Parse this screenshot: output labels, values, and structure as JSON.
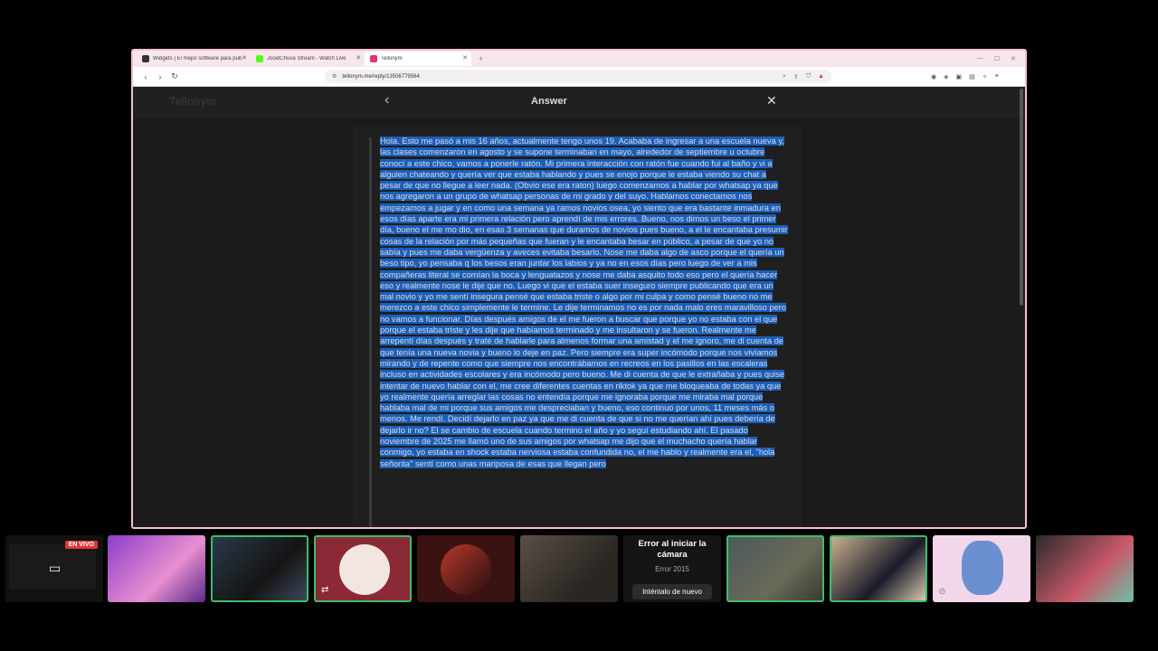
{
  "browser": {
    "tabs": [
      {
        "title": "Widgets | El mejor software para pub",
        "favicon_color": "#333333"
      },
      {
        "title": "JooidChuva Stream - Watch Live",
        "favicon_color": "#53fc18"
      },
      {
        "title": "Tellonym",
        "favicon_color": "#e5326b"
      }
    ],
    "new_tab": "+",
    "url": "tellonym.me/reply/13506779564"
  },
  "page": {
    "site_name": "Tellonym",
    "dialog_title": "Answer",
    "back_icon": "‹",
    "close_icon": "✕",
    "message": "Hola. Esto me pasó a mis 16 años, actualmente tengo unos 19. Acababa de ingresar a una escuela nueva y, las clases comenzaron en agosto y se supone terminaban en mayo, alrededor de septiembre u octubre conocí a este chico, vamos a ponerle ratón. Mi primera interacción con ratón fue cuando fui al baño y vi a alguien chateando y quería ver que estaba hablando y pues se enojo porque le estaba viendo su chat a pesar de que no llegue a leer nada. (Obvio ese era raton) luego comenzamos a hablar por whatsap ya que nos agregaron a un grupo de whatsap personas de mi grado y del suyo. Hablamos conectamos nos empezamos a jugar y en como una semana ya ramos novios osea, yo siento que era bastante inmadura en esos días aparte era mi primera relación pero aprendí de mis errores. Bueno, nos dimos un beso el primer día, bueno el me mo dio, en esas 3 semanas que duramos de novios pues bueno, a el le encantaba presumir cosas de la relación por más pequeñas que fueran y le encantaba besar en público, a pesar de que yo no sabía y pues me daba vergüenza y aveces evitaba besarlo. Nose me daba algo de asco porque el quería un beso tipo, yo pensaba q los besos eran juntar los labios y ya no en esos días pero luego de ver a mis compañeras literal se comían la boca y lenguatazos y nose me daba asquito todo eso pero el quería hacer eso y realmente nose le dije que no. Luego vi que el estaba suer inseguro siempre publicando que era un mal novio y yo me sentí insegura pensé que estaba triste o algo por mi culpa y como pensé bueno no me merezco a este chico simplemente le termine. Le dije terminamos no es por nada malo eres maravilloso pero no vamos a funcionar. Días después amigos de el me fueron a buscar que porque yo no estaba con el que porque el estaba triste y les dije que habíamos terminado y me insultaron y se fueron. Realmente me arrepentí días después y traté de hablarle para almenos formar una amistad y el me ignoro, me di cuenta de que tenía una nueva novia y bueno lo deje en paz. Pero siempre era super incómodo porque nos vivíamos mirando y de repente como que siempre nos encontrábamos en recreos en los pasillos en las escaleras incluso en actividades escolares y era incómodo pero bueno. Me di cuenta de que le extrañaba y pues quise intentar de nuevo hablar con el, me cree diferentes cuentas en riktok ya que me bloqueaba de todas ya que yo realmente quería arreglar las cosas no entendía porque me ignoraba porque me miraba mal porque hablaba mal de mi porque sus amigos me despreciaban y bueno, eso continuo por unos, 11 meses más o menos. Me rendí. Decidí dejarlo en paz ya que me di cuenta de que si no me querían ahí pues debería de dejarlo ir no? El se cambio de escuela cuando termino el año y yo seguí estudiando ahí. El pasado noviembre de 2025 me llamó uno de sus amigos por whatsap me dijo que el muchacho quería hablar conmigo, yo estaba en shock estaba nerviosa estaba confundida no, el me hablo y realmente era el, \"hola señorita\" sentí como unas mariposa de esas que llegan pero"
  },
  "stream_strip": {
    "live_badge": "EN VIVO",
    "camera_error": {
      "title": "Error al iniciar la cámara",
      "code": "Error 2015",
      "retry_label": "Inténtalo de nuevo"
    }
  },
  "colors": {
    "highlight": "#1c5fb8",
    "speaking_border": "#3dbd6d",
    "live_badge": "#e0363b"
  }
}
